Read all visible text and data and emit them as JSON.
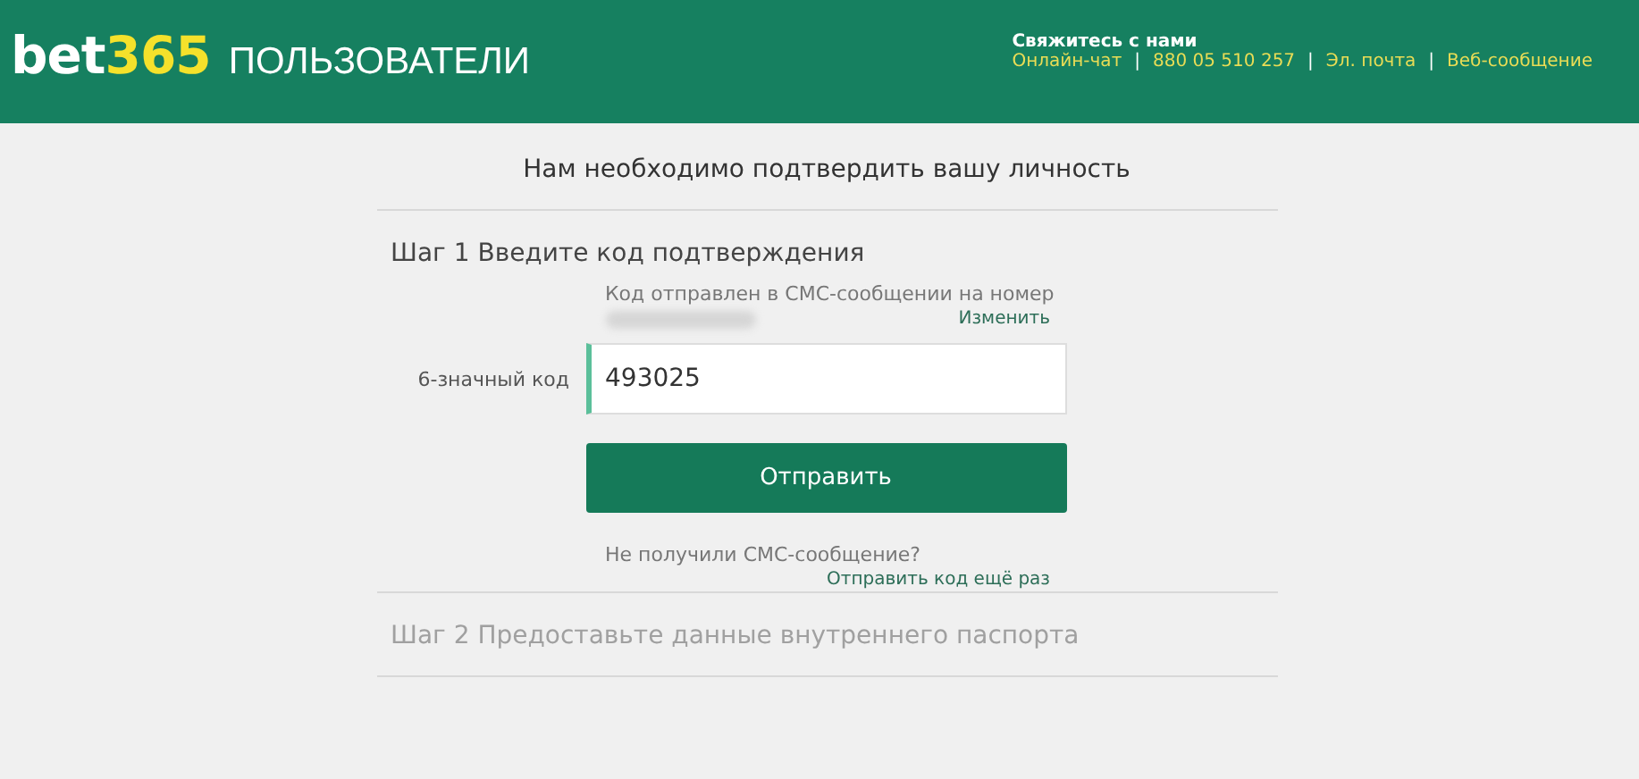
{
  "header": {
    "logo": {
      "word": "bet",
      "number": "365"
    },
    "section": "ПОЛЬЗОВАТЕЛИ",
    "contact": {
      "title": "Свяжитесь с нами",
      "items": [
        {
          "kind": "link",
          "text": "Онлайн-чат"
        },
        {
          "kind": "separator",
          "text": "|"
        },
        {
          "kind": "link",
          "text": "880 05 510 257"
        },
        {
          "kind": "separator",
          "text": "|"
        },
        {
          "kind": "link",
          "text": "Эл. почта"
        },
        {
          "kind": "separator",
          "text": "|"
        },
        {
          "kind": "link",
          "text": "Веб-сообщение"
        }
      ]
    }
  },
  "title": "Нам необходимо подтвердить вашу личность",
  "steps": [
    {
      "heading": "Шаг 1 Введите код подтверждения",
      "disabled": false,
      "sent_note": "Код отправлен в СМС-сообщении на номер",
      "change_link": "Изменить",
      "code_label": "6-значный код",
      "code_value": "493025",
      "submit": "Отправить",
      "not_received": "Не получили СМС-сообщение?",
      "resend_link": "Отправить код ещё раз"
    },
    {
      "heading": "Шаг 2 Предоставьте данные внутреннего паспорта",
      "disabled": true
    }
  ]
}
